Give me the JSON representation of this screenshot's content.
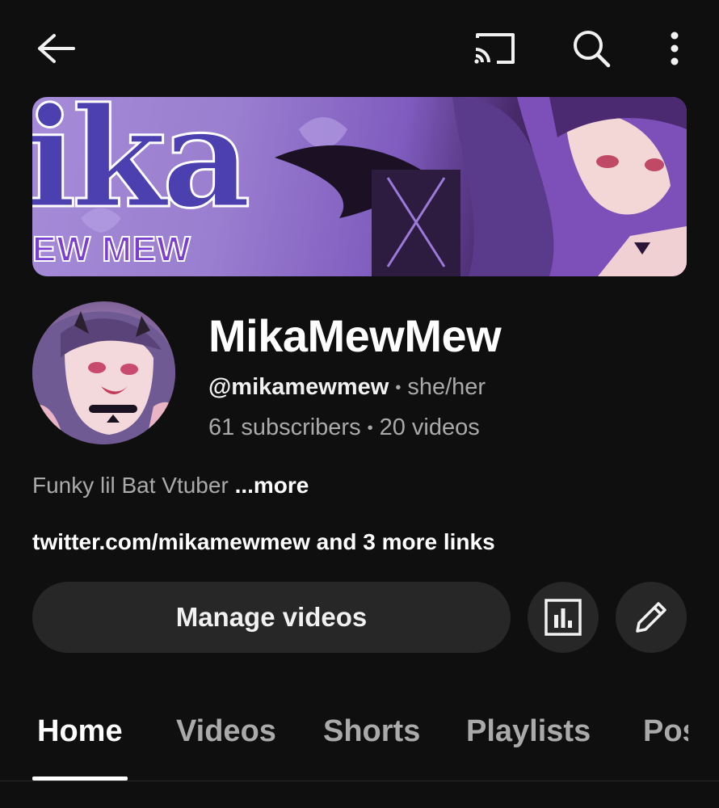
{
  "icons": {
    "back": "arrow-left-icon",
    "cast": "cast-icon",
    "search": "search-icon",
    "more": "more-vertical-icon",
    "analytics": "analytics-icon",
    "edit": "pencil-icon"
  },
  "banner": {
    "title": "ika",
    "subtitle": "EW MEW"
  },
  "channel": {
    "name": "MikaMewMew",
    "handle": "@mikamewmew",
    "pronouns": "she/her",
    "subscribers": "61 subscribers",
    "videos": "20 videos",
    "separator": "•",
    "description": "Funky lil Bat Vtuber",
    "more_label": "...more",
    "links": "twitter.com/mikamewmew and 3 more links"
  },
  "actions": {
    "manage_label": "Manage videos"
  },
  "tabs": [
    {
      "label": "Home",
      "active": true
    },
    {
      "label": "Videos",
      "active": false
    },
    {
      "label": "Shorts",
      "active": false
    },
    {
      "label": "Playlists",
      "active": false
    },
    {
      "label": "Posts",
      "active": false
    }
  ],
  "colors": {
    "background": "#0f0f0f",
    "button_bg": "#272727",
    "text_primary": "#f1f1f1",
    "text_secondary": "#aaaaaa"
  }
}
